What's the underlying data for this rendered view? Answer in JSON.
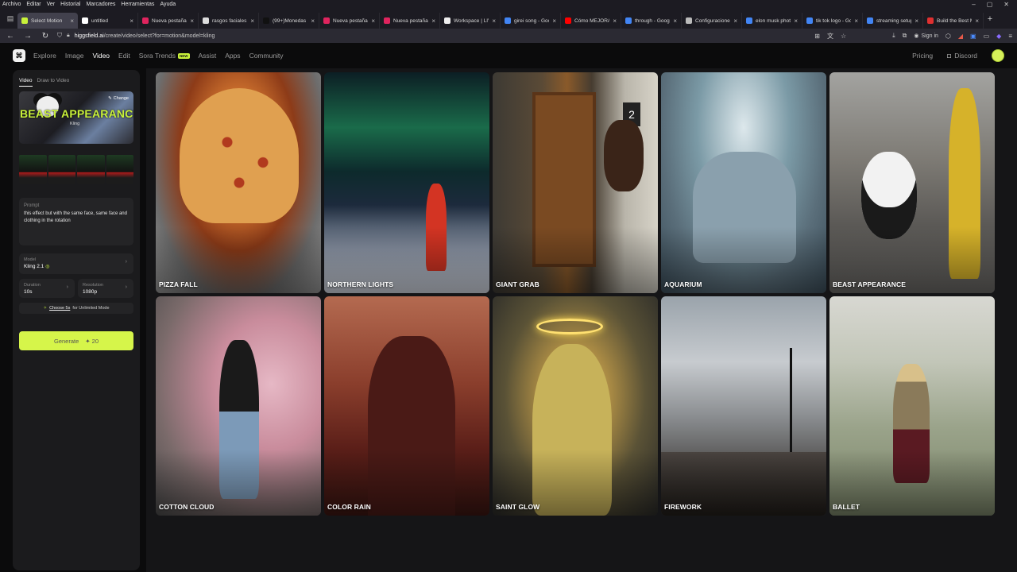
{
  "os_menu": [
    "Archivo",
    "Editar",
    "Ver",
    "Historial",
    "Marcadores",
    "Herramientas",
    "Ayuda"
  ],
  "window_controls": [
    "–",
    "▢",
    "✕"
  ],
  "tabs": [
    {
      "title": "Select Motion",
      "color": "#c9f23a",
      "active": true
    },
    {
      "title": "untitled",
      "color": "#ffffff"
    },
    {
      "title": "Nueva pestaña",
      "color": "#e0245e"
    },
    {
      "title": "rasgos faciales en",
      "color": "#dddddd"
    },
    {
      "title": "(99+)Monedas de",
      "color": "#111111"
    },
    {
      "title": "Nueva pestaña",
      "color": "#e0245e"
    },
    {
      "title": "Nueva pestaña",
      "color": "#e0245e"
    },
    {
      "title": "Workspace | LIVE",
      "color": "#eeeeee"
    },
    {
      "title": "girei song - Goog",
      "color": "#4285f4"
    },
    {
      "title": "Cómo MEJORAR",
      "color": "#ff0000"
    },
    {
      "title": "through - Google",
      "color": "#4285f4"
    },
    {
      "title": "Configuraciones",
      "color": "#bbbbbb"
    },
    {
      "title": "elon musk photo",
      "color": "#4285f4"
    },
    {
      "title": "tik tok logo - Goo",
      "color": "#4285f4"
    },
    {
      "title": "streaming setup",
      "color": "#4285f4"
    },
    {
      "title": "Build the Best M",
      "color": "#e03030"
    }
  ],
  "url": {
    "host": "higgsfield.ai",
    "path": "/create/video/select?for=motion&model=kling"
  },
  "signin_label": "Sign in",
  "app": {
    "nav": [
      {
        "label": "Explore"
      },
      {
        "label": "Image"
      },
      {
        "label": "Video",
        "active": true
      },
      {
        "label": "Edit"
      },
      {
        "label": "Sora Trends",
        "badge": "NEW"
      },
      {
        "label": "Assist"
      },
      {
        "label": "Apps"
      },
      {
        "label": "Community"
      }
    ],
    "pricing": "Pricing",
    "discord": "Discord"
  },
  "sidebar": {
    "tab_video": "Video",
    "tab_draw": "Draw to Video",
    "preset_title": "BEAST APPEARANCE",
    "preset_sub": "Kling",
    "change_label": "Change",
    "prompt_label": "Prompt",
    "prompt_text": "this effect but with the same face, same face and clothing in the rotation",
    "model_label": "Model",
    "model_value": "Kling 2.1",
    "duration_label": "Duration",
    "duration_value": "10s",
    "resolution_label": "Resolution",
    "resolution_value": "1080p",
    "upsell_link": "Choose 5s",
    "upsell_rest": "for Unlimited Mode",
    "generate_label": "Generate",
    "generate_cost": "20"
  },
  "effects": [
    "PIZZA FALL",
    "NORTHERN LIGHTS",
    "GIANT GRAB",
    "AQUARIUM",
    "BEAST APPEARANCE",
    "COTTON CLOUD",
    "COLOR RAIN",
    "SAINT GLOW",
    "FIREWORK",
    "BALLET"
  ]
}
